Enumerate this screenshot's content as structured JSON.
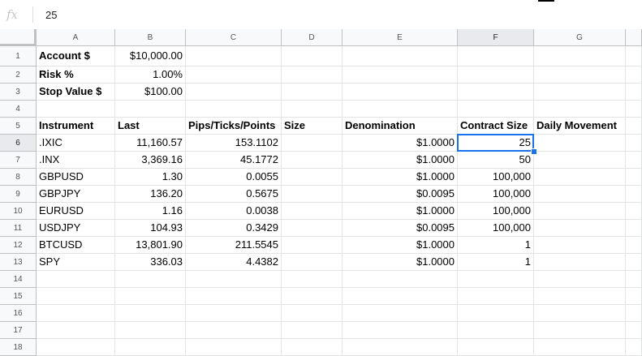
{
  "formula_bar": {
    "icon": "fx",
    "value": "25"
  },
  "columns": [
    "A",
    "B",
    "C",
    "D",
    "E",
    "F",
    "G"
  ],
  "rows": [
    "1",
    "2",
    "3",
    "4",
    "5",
    "6",
    "7",
    "8",
    "9",
    "10",
    "11",
    "12",
    "13",
    "14",
    "15",
    "16",
    "17",
    "18"
  ],
  "active": {
    "column": "F",
    "row": "6"
  },
  "cells": {
    "A1": "Account $",
    "B1": "$10,000.00",
    "A2": "Risk %",
    "B2": "1.00%",
    "A3": "Stop Value $",
    "B3": "$100.00",
    "A5": "Instrument",
    "B5": "Last",
    "C5": "Pips/Ticks/Points",
    "D5": "Size",
    "E5": "Denomination",
    "F5": "Contract Size",
    "G5": "Daily Movement",
    "A6": ".IXIC",
    "B6": "11,160.57",
    "C6": "153.1102",
    "E6": "$1.0000",
    "F6": "25",
    "A7": ".INX",
    "B7": "3,369.16",
    "C7": "45.1772",
    "E7": "$1.0000",
    "F7": "50",
    "A8": "GBPUSD",
    "B8": "1.30",
    "C8": "0.0055",
    "E8": "$1.0000",
    "F8": "100,000",
    "A9": "GBPJPY",
    "B9": "136.20",
    "C9": "0.5675",
    "E9": "$0.0095",
    "F9": "100,000",
    "A10": "EURUSD",
    "B10": "1.16",
    "C10": "0.0038",
    "E10": "$1.0000",
    "F10": "100,000",
    "A11": "USDJPY",
    "B11": "104.93",
    "C11": "0.3429",
    "E11": "$0.0095",
    "F11": "100,000",
    "A12": "BTCUSD",
    "B12": "13,801.90",
    "C12": "211.5545",
    "E12": "$1.0000",
    "F12": "1",
    "A13": "SPY",
    "B13": "336.03",
    "C13": "4.4382",
    "E13": "$1.0000",
    "F13": "1"
  }
}
